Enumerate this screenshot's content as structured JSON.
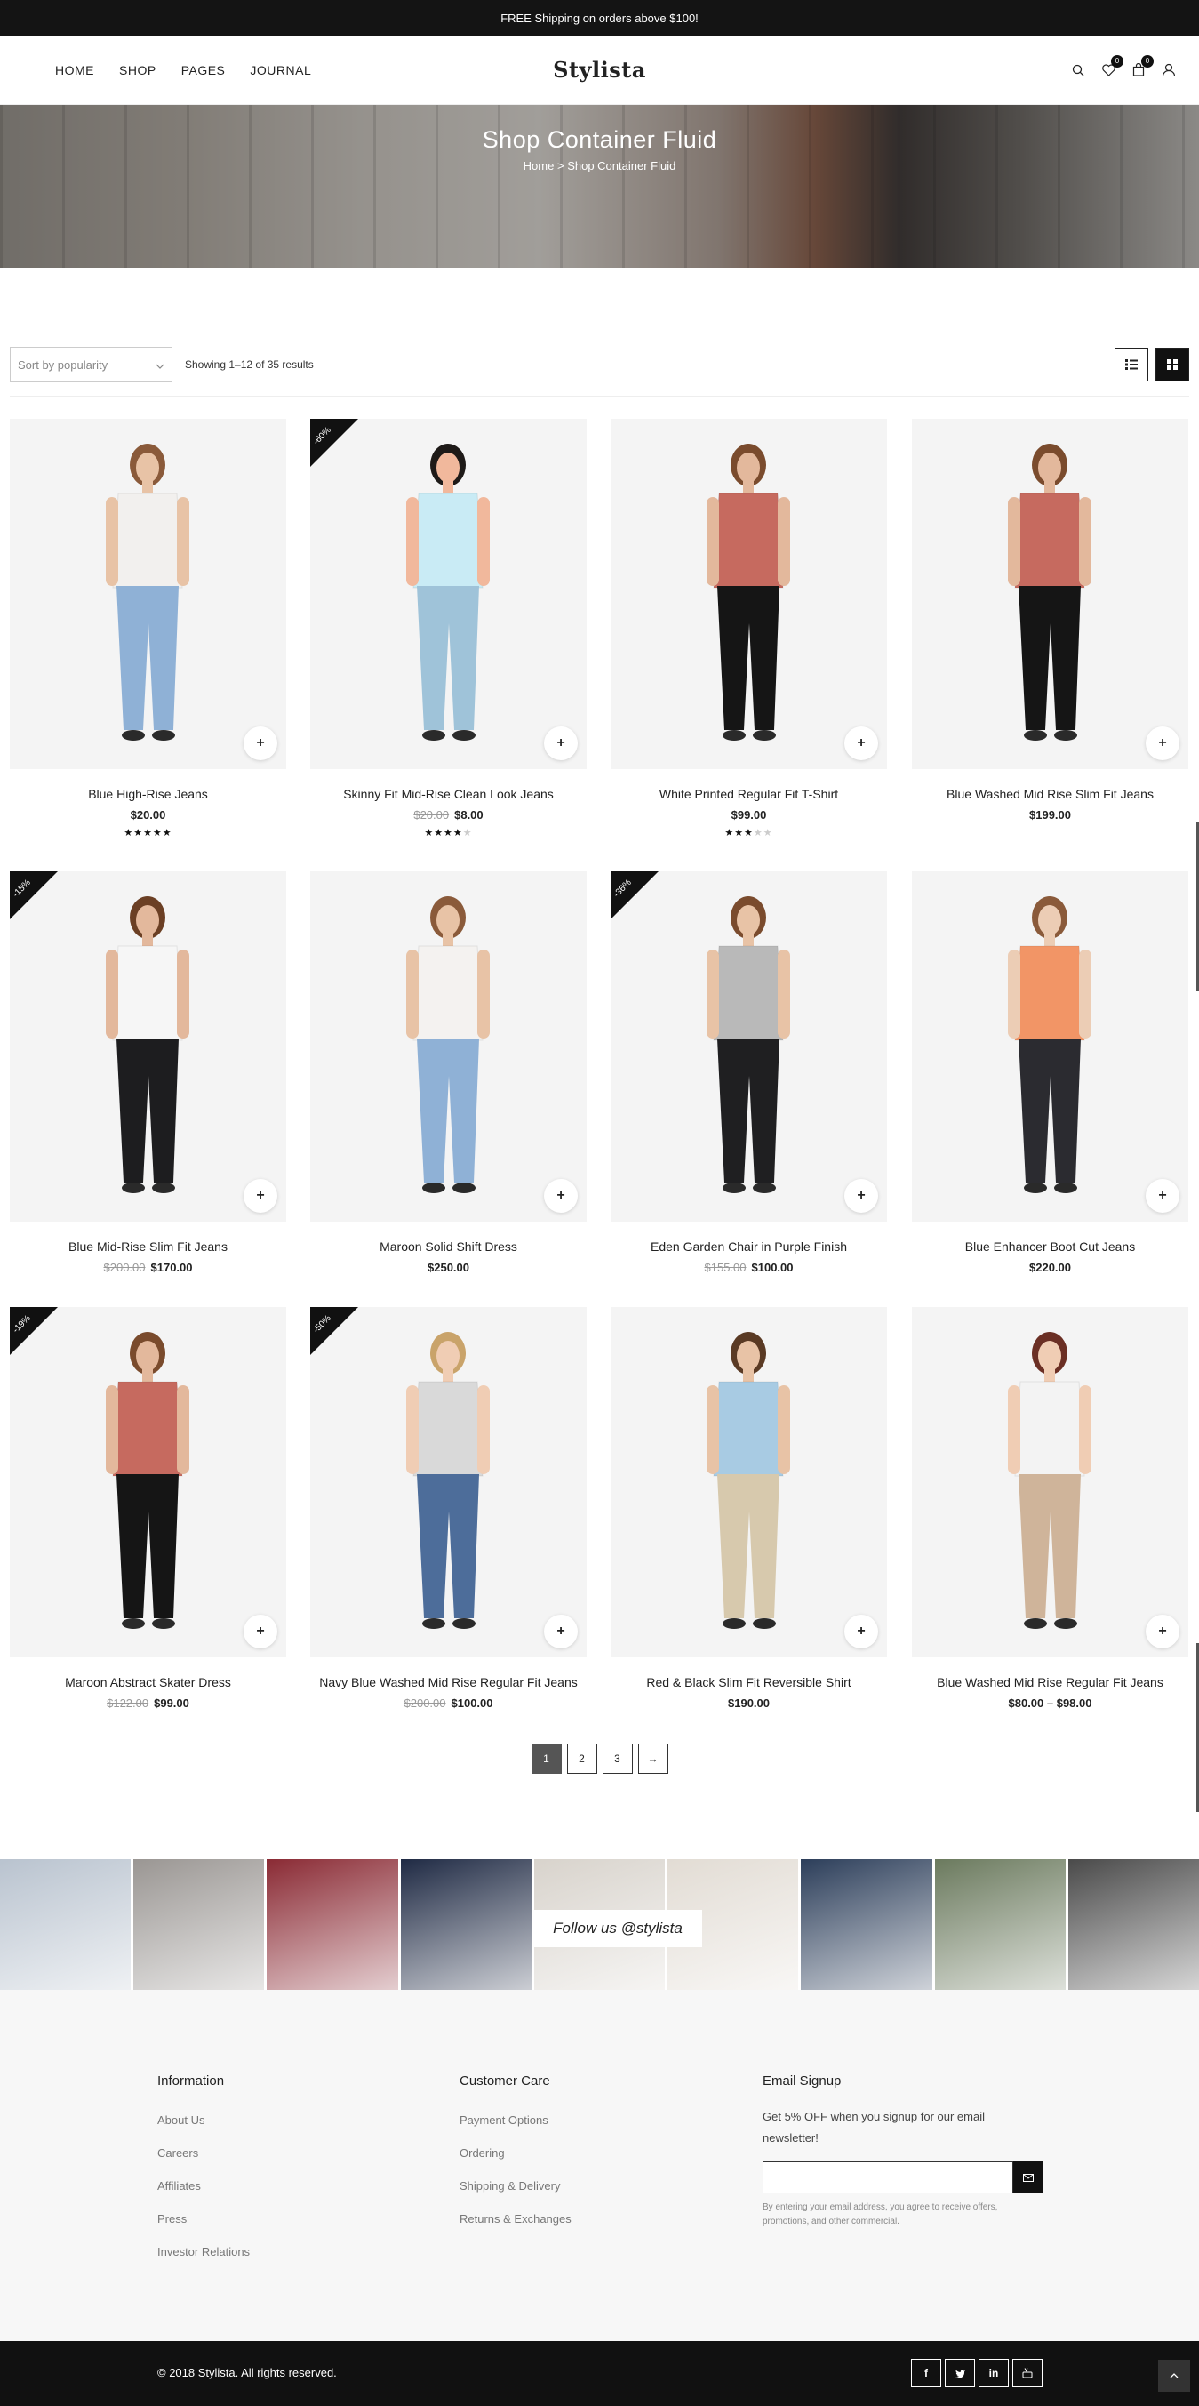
{
  "topbar": {
    "text": "FREE Shipping on orders above $100!"
  },
  "header": {
    "nav": [
      "HOME",
      "SHOP",
      "PAGES",
      "JOURNAL"
    ],
    "logo": "Stylista",
    "wishlist_count": "0",
    "cart_count": "0"
  },
  "hero": {
    "title": "Shop Container Fluid",
    "breadcrumb_home": "Home",
    "breadcrumb_sep": ">",
    "breadcrumb_current": "Shop Container Fluid"
  },
  "toolbar": {
    "sort_placeholder": "Sort by popularity",
    "showing": "Showing 1–12 of 35 results"
  },
  "products": [
    {
      "name": "Blue High-Rise Jeans",
      "price": "$20.00",
      "old": "",
      "sale": "",
      "rating": 5,
      "top": "#f2f0ee",
      "bottom": "#8fb1d6",
      "skin": "#e8c3a6",
      "hair": "#8a5a3a"
    },
    {
      "name": "Skinny Fit Mid-Rise Clean Look Jeans",
      "price": "$8.00",
      "old": "$20.00",
      "sale": "-60%",
      "rating": 4,
      "top": "#c9ebf5",
      "bottom": "#9fc3d9",
      "skin": "#f1b89c",
      "hair": "#1e1a18"
    },
    {
      "name": "White Printed Regular Fit T-Shirt",
      "price": "$99.00",
      "old": "",
      "sale": "",
      "rating": 3,
      "top": "#c66a5f",
      "bottom": "#151515",
      "skin": "#e3b89c",
      "hair": "#7a4b2d"
    },
    {
      "name": "Blue Washed Mid Rise Slim Fit Jeans",
      "price": "$199.00",
      "old": "",
      "sale": "",
      "rating": 0,
      "top": "#c66a5f",
      "bottom": "#151515",
      "skin": "#e3b89c",
      "hair": "#7a4b2d"
    },
    {
      "name": "Blue Mid-Rise Slim Fit Jeans",
      "price": "$170.00",
      "old": "$200.00",
      "sale": "-15%",
      "rating": 0,
      "top": "#f6f6f6",
      "bottom": "#1d1d1f",
      "skin": "#e3b89c",
      "hair": "#6b3f24"
    },
    {
      "name": "Maroon Solid Shift Dress",
      "price": "$250.00",
      "old": "",
      "sale": "",
      "rating": 0,
      "top": "#f4f2f0",
      "bottom": "#8fb1d6",
      "skin": "#e8c3a6",
      "hair": "#8a5a3a"
    },
    {
      "name": "Eden Garden Chair in Purple Finish",
      "price": "$100.00",
      "old": "$155.00",
      "sale": "-36%",
      "rating": 0,
      "top": "#b9b9b9",
      "bottom": "#1f1f21",
      "skin": "#e8c3a6",
      "hair": "#7a4b2d"
    },
    {
      "name": "Blue Enhancer Boot Cut Jeans",
      "price": "$220.00",
      "old": "",
      "sale": "",
      "rating": 0,
      "top": "#f29566",
      "bottom": "#2b2b30",
      "skin": "#eccdb5",
      "hair": "#8a5a3a"
    },
    {
      "name": "Maroon Abstract Skater Dress",
      "price": "$99.00",
      "old": "$122.00",
      "sale": "-19%",
      "rating": 0,
      "top": "#c66a5f",
      "bottom": "#151515",
      "skin": "#e3b89c",
      "hair": "#7a4b2d"
    },
    {
      "name": "Navy Blue Washed Mid Rise Regular Fit Jeans",
      "price": "$100.00",
      "old": "$200.00",
      "sale": "-50%",
      "rating": 0,
      "top": "#d9d9d9",
      "bottom": "#4d6d9a",
      "skin": "#f0cdb4",
      "hair": "#c9a36a"
    },
    {
      "name": "Red & Black Slim Fit Reversible Shirt",
      "price": "$190.00",
      "old": "",
      "sale": "",
      "rating": 0,
      "top": "#a8cbe3",
      "bottom": "#d7c9ad",
      "skin": "#e8c3a6",
      "hair": "#5a3a24"
    },
    {
      "name": "Blue Washed Mid Rise Regular Fit Jeans",
      "price": "$80.00 – $98.00",
      "old": "",
      "sale": "",
      "rating": 0,
      "top": "#f3f3f3",
      "bottom": "#cfb49a",
      "skin": "#f0cdb4",
      "hair": "#6b2f24"
    }
  ],
  "pagination": [
    "1",
    "2",
    "3",
    "→"
  ],
  "instagram": {
    "follow": "Follow us @stylista",
    "tiles": [
      "#b9c3cf",
      "#9a9693",
      "#8a2a34",
      "#1f2a44",
      "#d8d3cc",
      "#e2dcd4",
      "#2c3e5a",
      "#6b7a5e",
      "#4a4a4a"
    ]
  },
  "footer": {
    "info_title": "Information",
    "info_links": [
      "About Us",
      "Careers",
      "Affiliates",
      "Press",
      "Investor Relations"
    ],
    "care_title": "Customer Care",
    "care_links": [
      "Payment Options",
      "Ordering",
      "Shipping & Delivery",
      "Returns & Exchanges"
    ],
    "email_title": "Email Signup",
    "email_text": "Get 5% OFF when you signup for our email newsletter!",
    "email_note": "By entering your email address, you agree to receive offers, promotions, and other commercial.",
    "copyright": "© 2018 Stylista. All rights reserved.",
    "socials": [
      "f",
      "t",
      "in",
      "yt"
    ]
  }
}
